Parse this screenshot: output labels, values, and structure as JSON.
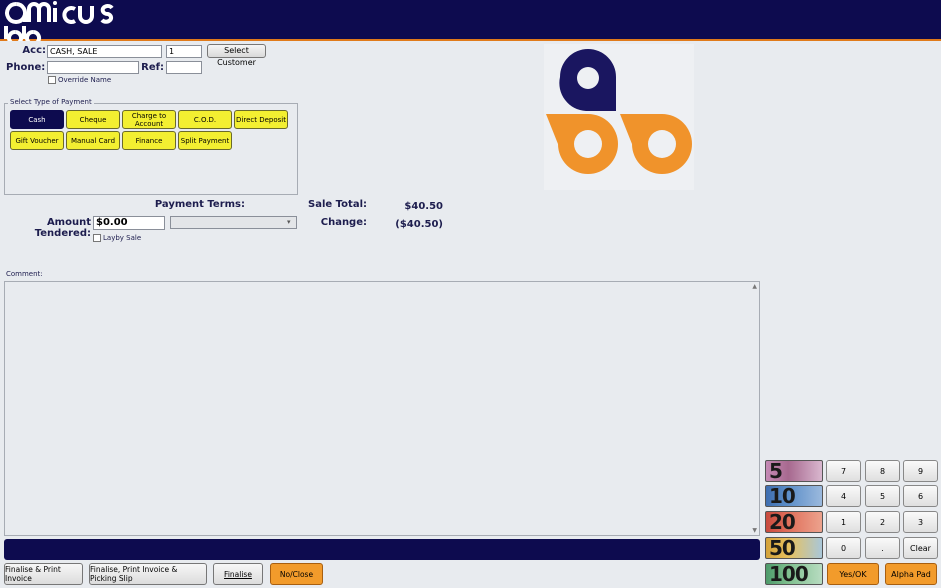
{
  "brand": {
    "name": "amicus"
  },
  "account": {
    "acc_label": "Acc:",
    "acc_value": "CASH, SALE",
    "acc_number": "1",
    "select_customer": "Select Customer",
    "phone_label": "Phone:",
    "phone_value": "",
    "ref_label": "Ref:",
    "ref_value": "",
    "override_name": "Override Name"
  },
  "payment": {
    "group_title": "Select Type of Payment",
    "types": [
      "Cash",
      "Cheque",
      "Charge to Account",
      "C.O.D.",
      "Direct Deposit",
      "Gift Voucher",
      "Manual Card",
      "Finance",
      "Split Payment"
    ],
    "selected": "Cash"
  },
  "terms": {
    "label": "Payment Terms:",
    "value": ""
  },
  "amount": {
    "label": "Amount Tendered:",
    "value": "$0.00",
    "layby": "Layby Sale"
  },
  "totals": {
    "sale_total_label": "Sale Total:",
    "sale_total_value": "$40.50",
    "change_label": "Change:",
    "change_value": "($40.50)"
  },
  "comment": {
    "label": "Comment:",
    "value": ""
  },
  "bottom_buttons": {
    "finalise_print": "Finalise & Print Invoice",
    "finalise_print_picking": "Finalise, Print Invoice & Picking Slip",
    "finalise": "Finalise",
    "no_close": "No/Close"
  },
  "notes": [
    "5",
    "10",
    "20",
    "50",
    "100"
  ],
  "keypad": {
    "row1": [
      "7",
      "8",
      "9"
    ],
    "row2": [
      "4",
      "5",
      "6"
    ],
    "row3": [
      "1",
      "2",
      "3"
    ],
    "row4": [
      "0",
      ".",
      "Clear"
    ],
    "yes_ok": "Yes/OK",
    "alpha_pad": "Alpha Pad"
  },
  "colors": {
    "navy": "#0d0b4f",
    "orange": "#f29b2b",
    "yellow": "#f3ef31"
  }
}
